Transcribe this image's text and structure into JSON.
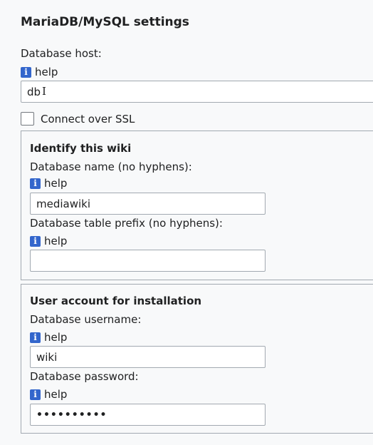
{
  "section": {
    "title": "MariaDB/MySQL settings"
  },
  "host": {
    "label": "Database host:",
    "help": "help",
    "value": "db"
  },
  "ssl": {
    "label": "Connect over SSL",
    "checked": false
  },
  "identify": {
    "legend": "Identify this wiki",
    "dbname_label": "Database name (no hyphens):",
    "dbname_help": "help",
    "dbname_value": "mediawiki",
    "prefix_label": "Database table prefix (no hyphens):",
    "prefix_help": "help",
    "prefix_value": ""
  },
  "account": {
    "legend": "User account for installation",
    "username_label": "Database username:",
    "username_help": "help",
    "username_value": "wiki",
    "password_label": "Database password:",
    "password_help": "help",
    "password_value": "••••••••••"
  },
  "icons": {
    "info": "info-icon",
    "text_cursor": "text-cursor-icon"
  },
  "colors": {
    "info_icon": "#3366cc",
    "border": "#a2a9b1",
    "background": "#f8f9fa"
  }
}
